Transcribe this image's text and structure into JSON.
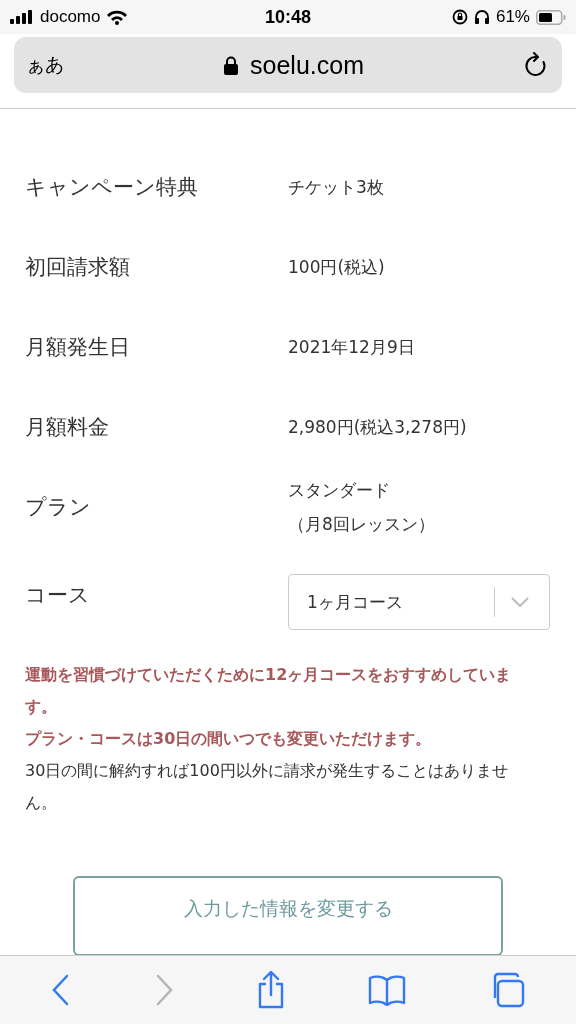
{
  "status_bar": {
    "carrier": "docomo",
    "time": "10:48",
    "battery": "61%"
  },
  "address_bar": {
    "text_size": "ぁあ",
    "url": "soelu.com"
  },
  "rows": [
    {
      "kind": "text",
      "label": "キャンペーン特典",
      "lines": [
        "チケット3枚"
      ]
    },
    {
      "kind": "text",
      "label": "初回請求額",
      "lines": [
        "100円(税込)"
      ]
    },
    {
      "kind": "text",
      "label": "月額発生日",
      "lines": [
        "2021年12月9日"
      ]
    },
    {
      "kind": "text",
      "label": "月額料金",
      "lines": [
        "2,980円(税込3,278円)"
      ]
    },
    {
      "kind": "text",
      "label": "プラン",
      "lines": [
        "スタンダード",
        "（月8回レッスン）"
      ]
    },
    {
      "kind": "select",
      "label": "コース",
      "value": "1ヶ月コース"
    }
  ],
  "notes": [
    {
      "kind": "emphasis",
      "text": "運動を習慣づけていただくために12ヶ月コースをおすすめしています。"
    },
    {
      "kind": "emphasis",
      "text": "プラン・コースは30日の間いつでも変更いただけます。"
    },
    {
      "kind": "normal",
      "text": "30日の間に解約すれば100円以外に請求が発生することはありません。"
    }
  ],
  "change_button": "入力した情報を変更する",
  "toolbar": {
    "back_disabled": false,
    "forward_disabled": true
  }
}
